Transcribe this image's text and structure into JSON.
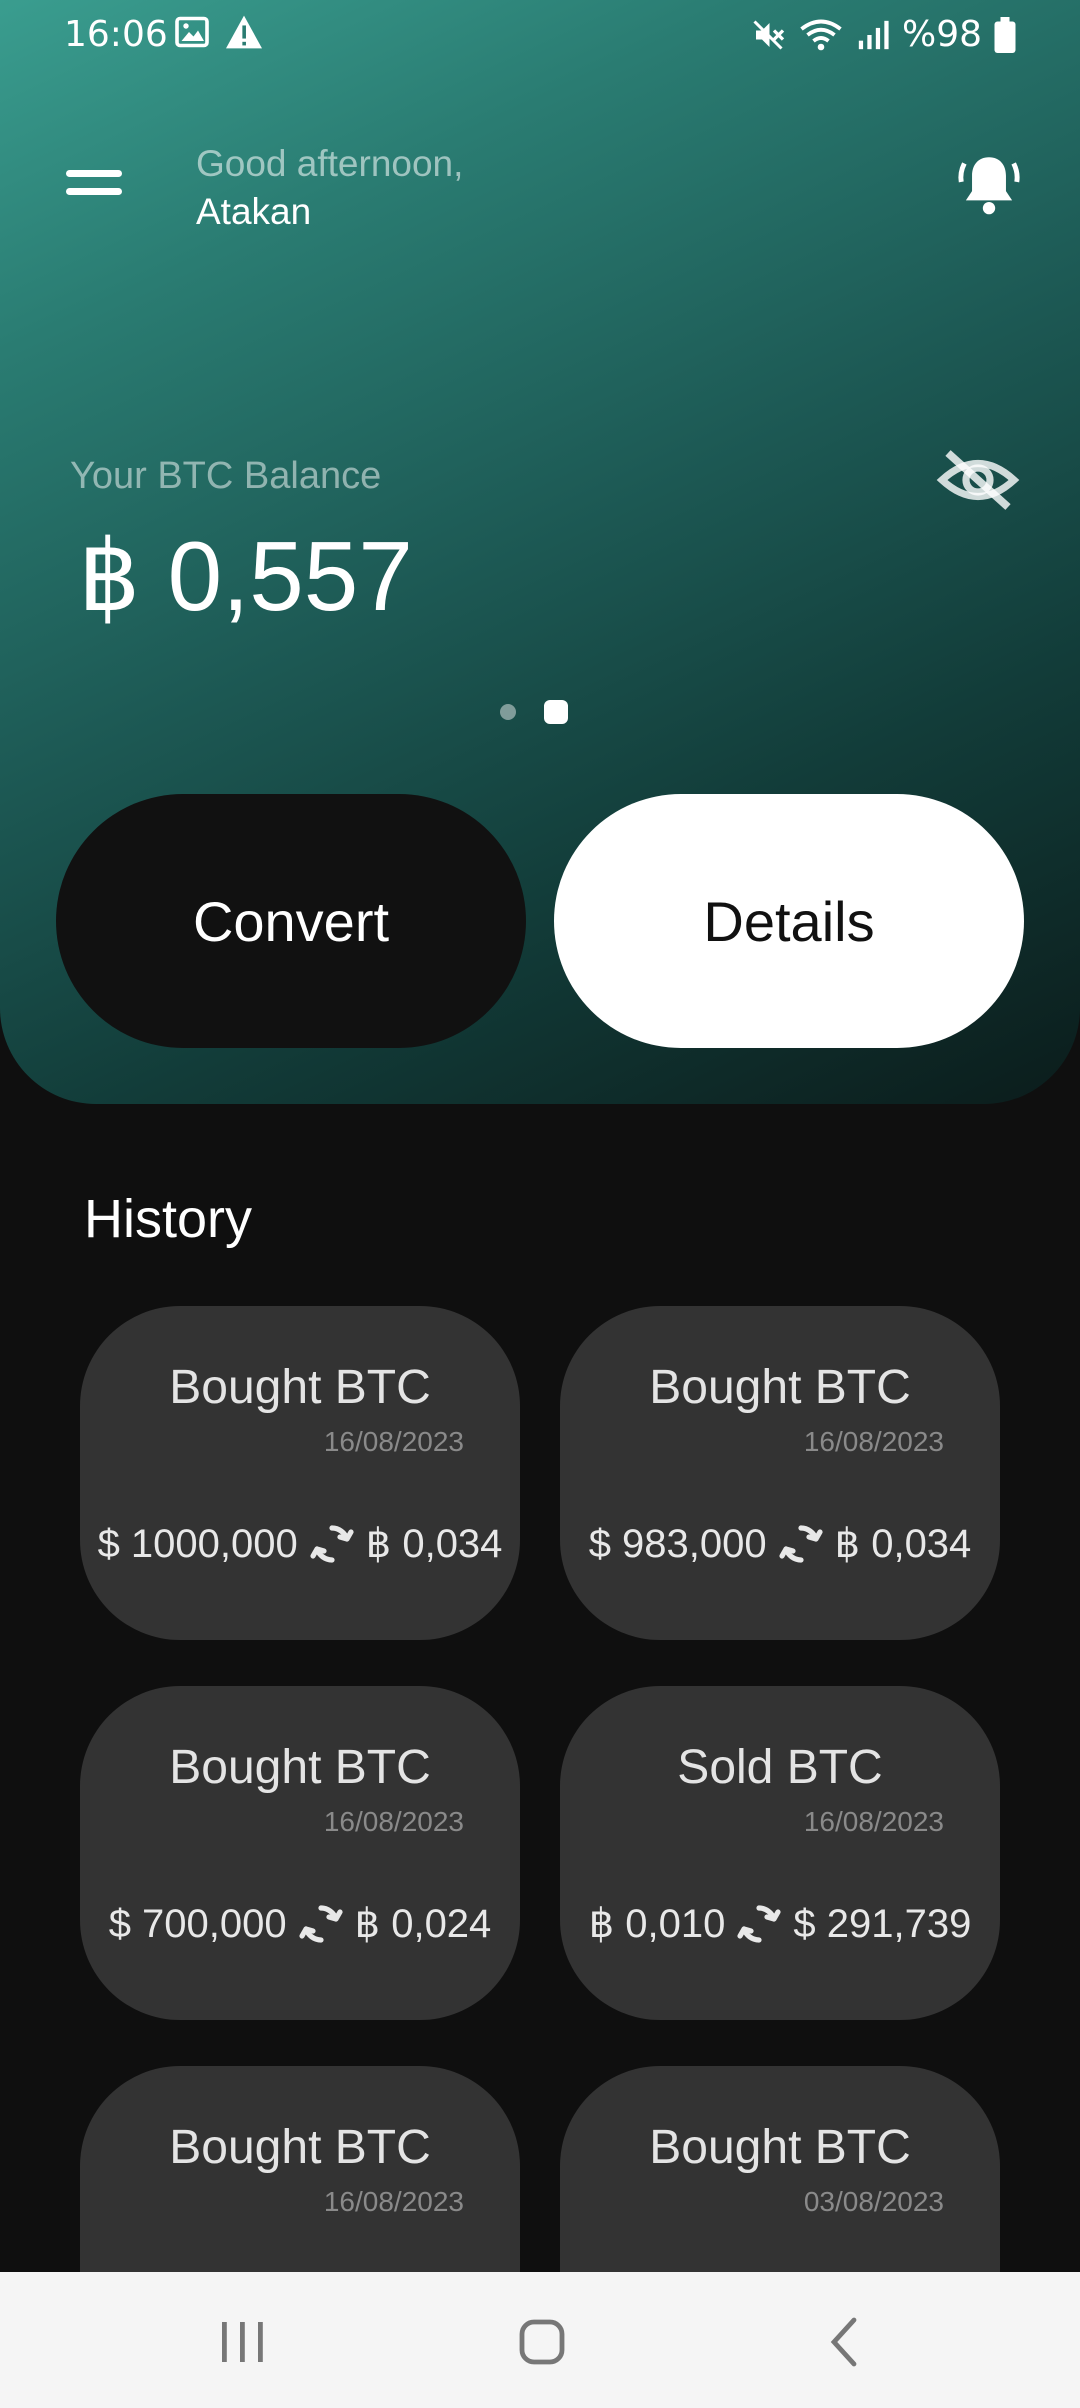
{
  "status_bar": {
    "time": "16:06",
    "battery_text": "%98",
    "icons": [
      "image-icon",
      "warning-icon",
      "mute-icon",
      "wifi-icon",
      "signal-icon",
      "battery-icon"
    ]
  },
  "header": {
    "greeting_line1": "Good afternoon,",
    "greeting_line2": "Atakan"
  },
  "balance": {
    "label": "Your BTC Balance",
    "value": "฿ 0,557",
    "page_count": 2,
    "active_page": 2
  },
  "actions": {
    "convert_label": "Convert",
    "details_label": "Details"
  },
  "history": {
    "title": "History",
    "items": [
      {
        "title": "Bought BTC",
        "date": "16/08/2023",
        "from": "$ 1000,000",
        "to": "฿ 0,034"
      },
      {
        "title": "Bought BTC",
        "date": "16/08/2023",
        "from": "$ 983,000",
        "to": "฿ 0,034"
      },
      {
        "title": "Bought BTC",
        "date": "16/08/2023",
        "from": "$ 700,000",
        "to": "฿ 0,024"
      },
      {
        "title": "Sold BTC",
        "date": "16/08/2023",
        "from": "฿ 0,010",
        "to": "$ 291,739"
      },
      {
        "title": "Bought BTC",
        "date": "16/08/2023",
        "from": "",
        "to": ""
      },
      {
        "title": "Bought BTC",
        "date": "03/08/2023",
        "from": "",
        "to": ""
      }
    ]
  },
  "colors": {
    "accent_top": "#3a9d8f",
    "accent_bottom": "#0b1c1b",
    "card": "#333333",
    "background": "#0f0f0f"
  }
}
